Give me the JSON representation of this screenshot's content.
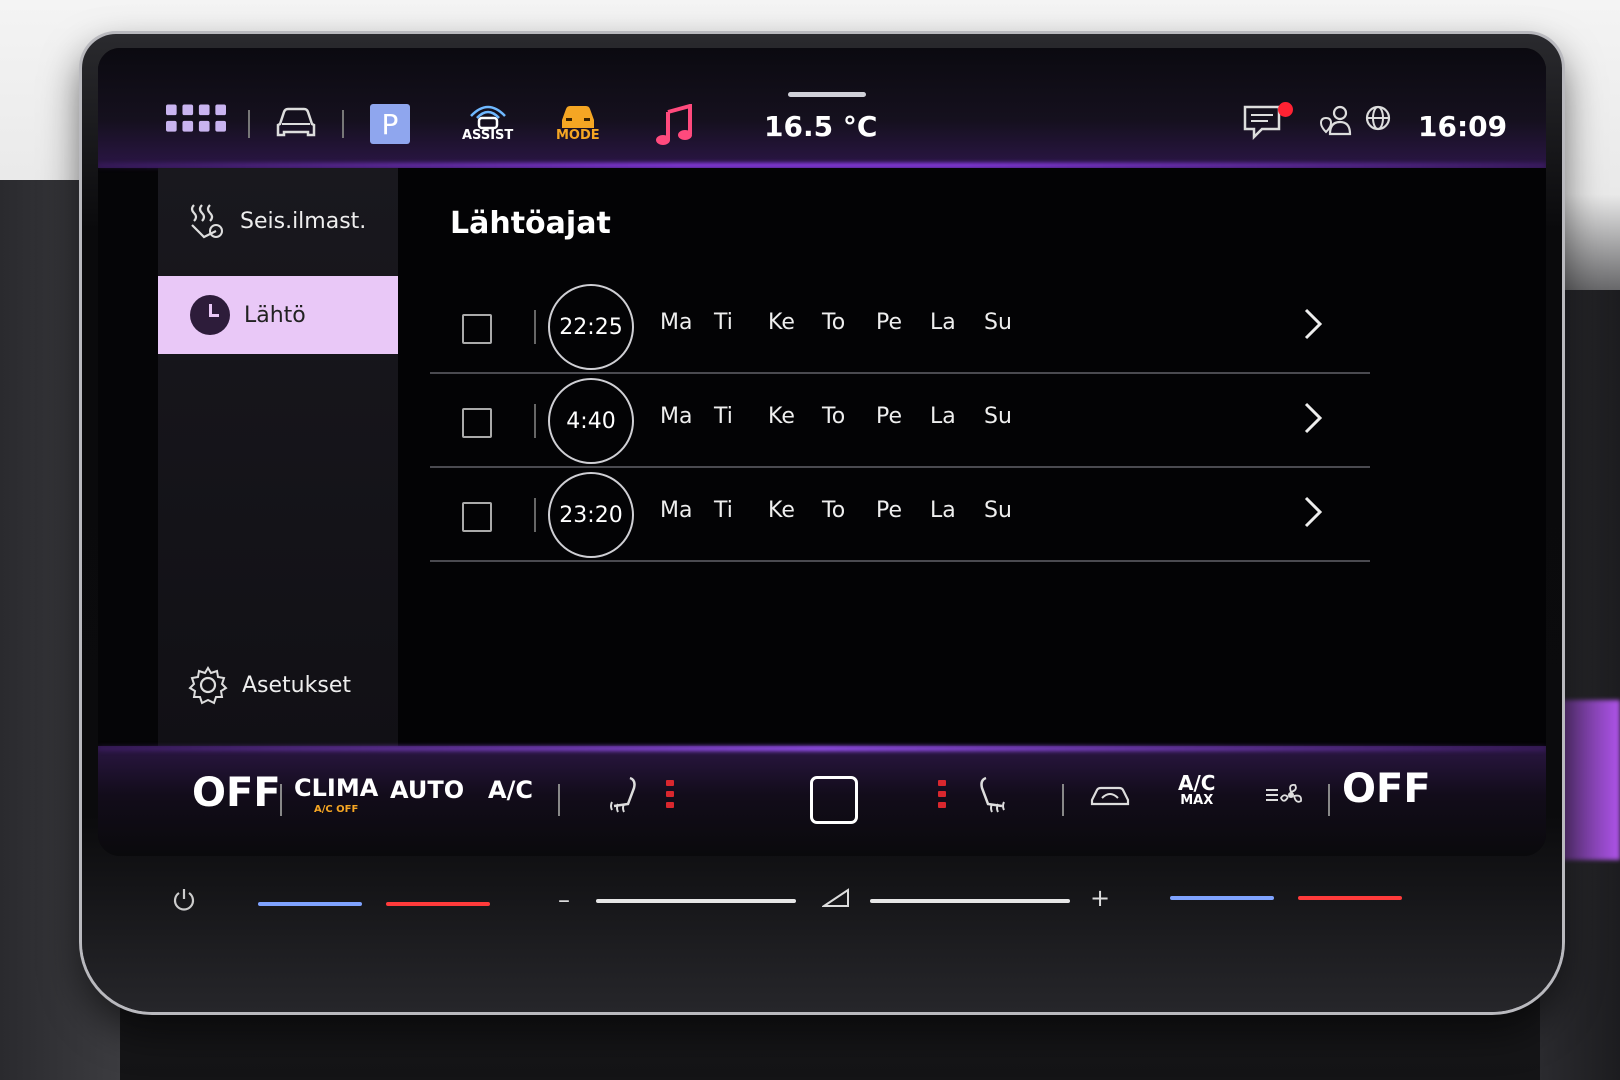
{
  "topbar": {
    "icons": [
      "apps-grid-icon",
      "car-icon",
      "parking-icon",
      "assist-icon",
      "mode-icon",
      "music-note-icon",
      "message-icon",
      "user-location-icon",
      "globe-icon"
    ],
    "parking_label": "P",
    "assist_label": "ASSIST",
    "mode_label": "MODE",
    "temperature": "16.5 °C",
    "time": "16:09",
    "colors": {
      "mode": "#f5a623",
      "music": "#ff4a7d",
      "notification": "#ff2233",
      "parking_bg": "#8fa6ee"
    }
  },
  "sidebar": {
    "items": [
      {
        "label": "Seis.ilmast.",
        "icon": "aux-climate-icon",
        "active": false
      },
      {
        "label": "Lähtö",
        "icon": "clock-icon",
        "active": true
      }
    ],
    "settings_label": "Asetukset",
    "active_color": "#e9c8f7"
  },
  "main": {
    "title": "Lähtöajat",
    "rows": [
      {
        "time": "22:25",
        "checked": false,
        "days": [
          "Ma",
          "Ti",
          "Ke",
          "To",
          "Pe",
          "La",
          "Su"
        ]
      },
      {
        "time": "4:40",
        "checked": false,
        "days": [
          "Ma",
          "Ti",
          "Ke",
          "To",
          "Pe",
          "La",
          "Su"
        ]
      },
      {
        "time": "23:20",
        "checked": false,
        "days": [
          "Ma",
          "Ti",
          "Ke",
          "To",
          "Pe",
          "La",
          "Su"
        ]
      }
    ]
  },
  "climate": {
    "left_off": "OFF",
    "clima": "CLIMA",
    "clima_sub": "A/C OFF",
    "auto": "AUTO",
    "ac": "A/C",
    "ac_max_top": "A/C",
    "ac_max_bottom": "MAX",
    "right_off": "OFF",
    "clima_sub_color": "#f5a623",
    "heat_color": "#d9272e"
  },
  "sliders": {
    "minus": "–",
    "plus": "+",
    "cold_color": "#7fa3ff",
    "hot_color": "#ff3b3b"
  }
}
